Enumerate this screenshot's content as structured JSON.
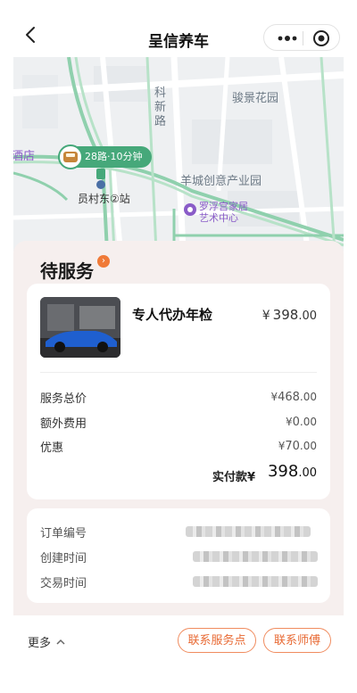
{
  "header": {
    "title": "呈信养车",
    "menu_glyph": "•••"
  },
  "map": {
    "labels": {
      "road_ke_xin": "科新路",
      "jun_jing": "骏景花园",
      "hotel_partial": "酒店",
      "bus_info": "28路·10分钟",
      "station": "员村东②站",
      "yang_cheng": "羊城创意产业园",
      "luofu_1": "罗浮宫家居",
      "luofu_2": "艺术中心"
    }
  },
  "order": {
    "status": "待服务",
    "service": {
      "name": "专人代办年检",
      "price_symbol": "¥",
      "price_int": "398",
      "price_dec": ".00"
    },
    "fees": [
      {
        "label": "服务总价",
        "value_symbol": "¥",
        "value_int": "468",
        "value_dec": ".00"
      },
      {
        "label": "额外费用",
        "value_symbol": "¥",
        "value_int": "0",
        "value_dec": ".00"
      },
      {
        "label": "优惠",
        "value_symbol": "¥",
        "value_int": "70",
        "value_dec": ".00"
      }
    ],
    "paid": {
      "label": "实付款",
      "symbol": "¥",
      "int": "398",
      "dec": ".00"
    },
    "info": [
      {
        "label": "订单编号"
      },
      {
        "label": "创建时间"
      },
      {
        "label": "交易时间"
      }
    ]
  },
  "footer": {
    "more": "更多",
    "contact_store": "联系服务点",
    "contact_tech": "联系师傅"
  },
  "colors": {
    "accent": "#e86a34",
    "bus_green": "#46a87a",
    "content_bg": "#f6efee"
  }
}
